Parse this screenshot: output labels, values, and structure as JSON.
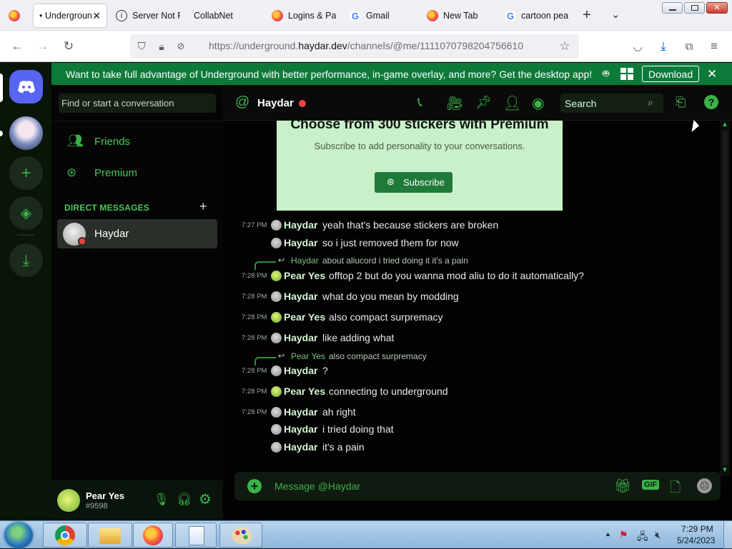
{
  "browser": {
    "tabs": [
      {
        "label": "• Undergroun",
        "active": true,
        "favicon": "firefox-icon"
      },
      {
        "label": "Server Not F",
        "favicon": "info-icon"
      },
      {
        "label": "CollabNet",
        "favicon": "none"
      },
      {
        "label": "Logins & Pa",
        "favicon": "firefox-icon"
      },
      {
        "label": "Gmail",
        "favicon": "google-icon"
      },
      {
        "label": "New Tab",
        "favicon": "firefox-icon"
      },
      {
        "label": "cartoon pea",
        "favicon": "google-icon"
      }
    ],
    "url_prefix": "https://underground.",
    "url_domain": "haydar.dev",
    "url_path": "/channels/@me/1111070798204756610"
  },
  "banner": {
    "text": "Want to take full advantage of Underground with better performance, in-game overlay, and more? Get the desktop app!",
    "download_label": "Download"
  },
  "dm": {
    "search_placeholder": "Find or start a conversation",
    "friends_label": "Friends",
    "premium_label": "Premium",
    "section_title": "DIRECT MESSAGES",
    "active_dm": "Haydar"
  },
  "user": {
    "name": "Pear Yes",
    "tag": "#9598"
  },
  "header": {
    "username": "Haydar",
    "search_placeholder": "Search"
  },
  "premium_card": {
    "title": "Choose from 300 stickers with Premium",
    "subtitle": "Subscribe to add personality to your conversations.",
    "button": "Subscribe"
  },
  "messages": [
    {
      "time": "7:27 PM",
      "author": "Haydar",
      "text": "yeah that's because stickers are broken"
    },
    {
      "time": "",
      "author": "Haydar",
      "text": "so i just removed them for now"
    },
    {
      "reply_author": "Haydar",
      "reply_text": "about aliucord i tried doing it it's a pain"
    },
    {
      "time": "7:28 PM",
      "author": "Pear Yes",
      "text": "offtop 2 but do you wanna mod aliu to do it automatically?"
    },
    {
      "time": "7:28 PM",
      "author": "Haydar",
      "text": "what do you mean by modding"
    },
    {
      "time": "7:28 PM",
      "author": "Pear Yes",
      "text": "also compact surpremacy"
    },
    {
      "time": "7:28 PM",
      "author": "Haydar",
      "text": "like adding what"
    },
    {
      "reply_author": "Pear Yes",
      "reply_text": "also compact surpremacy"
    },
    {
      "time": "7:28 PM",
      "author": "Haydar",
      "text": "?"
    },
    {
      "time": "7:28 PM",
      "author": "Pear Yes",
      "text": "connecting to underground"
    },
    {
      "time": "7:28 PM",
      "author": "Haydar",
      "text": "ah right"
    },
    {
      "time": "",
      "author": "Haydar",
      "text": "i tried doing that"
    },
    {
      "time": "",
      "author": "Haydar",
      "text": "it's a pain"
    }
  ],
  "composer": {
    "placeholder": "Message @Haydar"
  },
  "taskbar": {
    "time": "7:29 PM",
    "date": "5/24/2023"
  },
  "colors": {
    "accent": "#3bb24a",
    "banner": "#0d7a3a",
    "premium_card": "#c9f0c9",
    "subscribe": "#1f7a3a"
  }
}
